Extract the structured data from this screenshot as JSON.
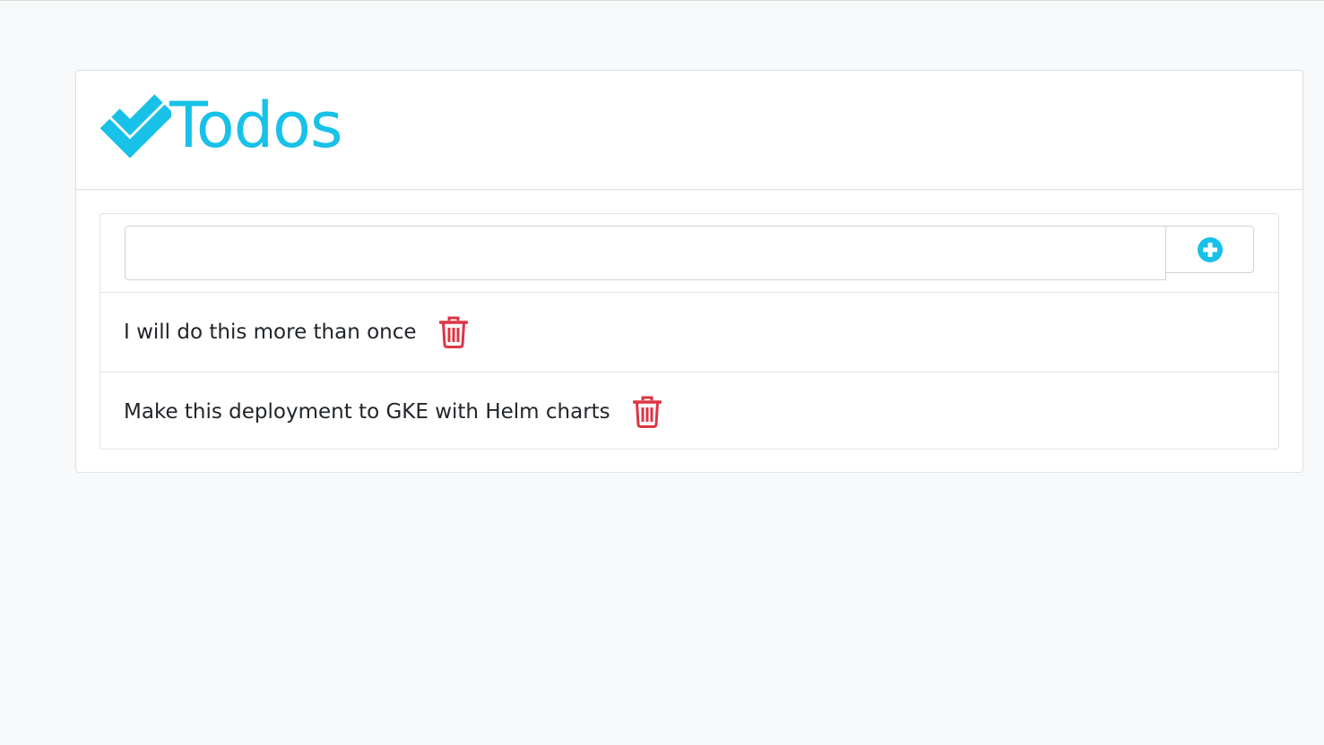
{
  "header": {
    "title": "Todos",
    "logo_icon": "double-check-icon",
    "accent_color": "#17c1e8"
  },
  "add_form": {
    "input_value": "",
    "input_placeholder": "",
    "add_icon": "plus-circle-icon"
  },
  "todos": [
    {
      "text": "I will do this more than once",
      "delete_icon": "trash-icon"
    },
    {
      "text": "Make this deployment to GKE with Helm charts",
      "delete_icon": "trash-icon"
    }
  ],
  "colors": {
    "accent": "#17c1e8",
    "danger": "#dc3545",
    "background": "#f8f9fa"
  }
}
